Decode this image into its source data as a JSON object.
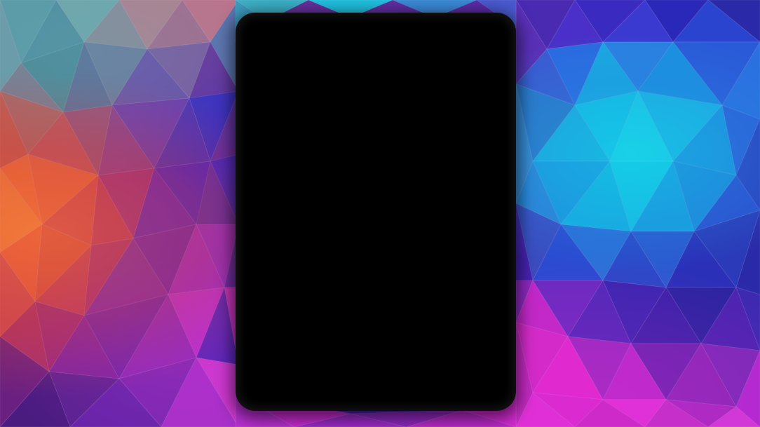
{
  "wallpaper": {
    "style": "low-poly geometric",
    "colors": {
      "teal": "#4aa0b0",
      "orange": "#ee6a3a",
      "crimson": "#c83a5a",
      "violet": "#5a28c8",
      "indigo": "#2a24b8",
      "blue": "#2a6ae0",
      "cyan": "#18c8e0",
      "magenta": "#c828c8",
      "navy": "#1e1a8a"
    }
  },
  "device": {
    "screen_color": "#000000",
    "state": "blank"
  }
}
